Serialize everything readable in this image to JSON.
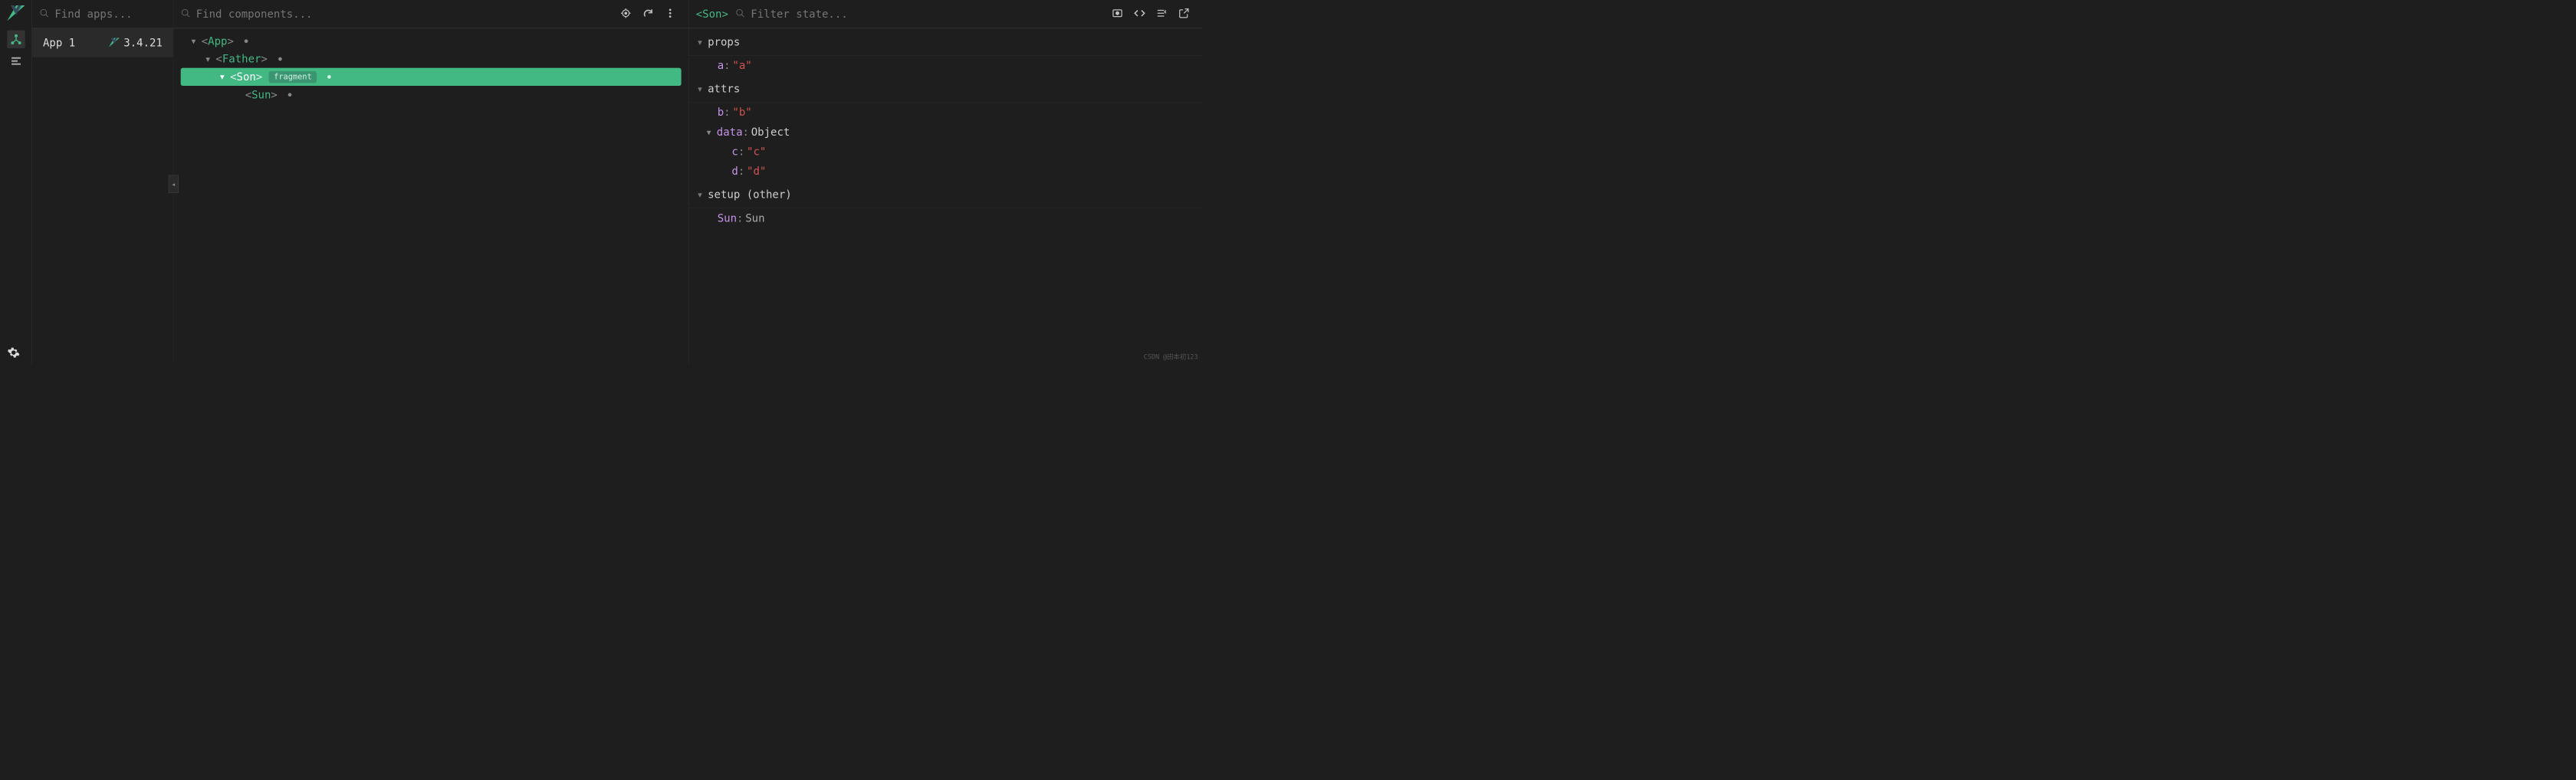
{
  "sidebar": {},
  "apps": {
    "search_placeholder": "Find apps...",
    "list": [
      {
        "name": "App 1",
        "version": "3.4.21"
      }
    ]
  },
  "components": {
    "search_placeholder": "Find components...",
    "tree": {
      "root": {
        "name": "App",
        "indent": 0
      },
      "father": {
        "name": "Father",
        "indent": 1
      },
      "son": {
        "name": "Son",
        "indent": 2,
        "badge": "fragment",
        "selected": true
      },
      "sun": {
        "name": "Sun",
        "indent": 3
      }
    }
  },
  "state": {
    "selected_component": "<Son>",
    "filter_placeholder": "Filter state...",
    "sections": {
      "props": {
        "title": "props",
        "items": [
          {
            "key": "a",
            "value": "\"a\"",
            "type": "string"
          }
        ]
      },
      "attrs": {
        "title": "attrs",
        "items": [
          {
            "key": "b",
            "value": "\"b\"",
            "type": "string"
          },
          {
            "key": "data",
            "value": "Object",
            "type": "object",
            "expanded": true,
            "children": [
              {
                "key": "c",
                "value": "\"c\"",
                "type": "string"
              },
              {
                "key": "d",
                "value": "\"d\"",
                "type": "string"
              }
            ]
          }
        ]
      },
      "setup": {
        "title": "setup (other)",
        "items": [
          {
            "key": "Sun",
            "value": "Sun",
            "type": "component"
          }
        ]
      }
    }
  },
  "watermark": "CSDN @田本初123"
}
